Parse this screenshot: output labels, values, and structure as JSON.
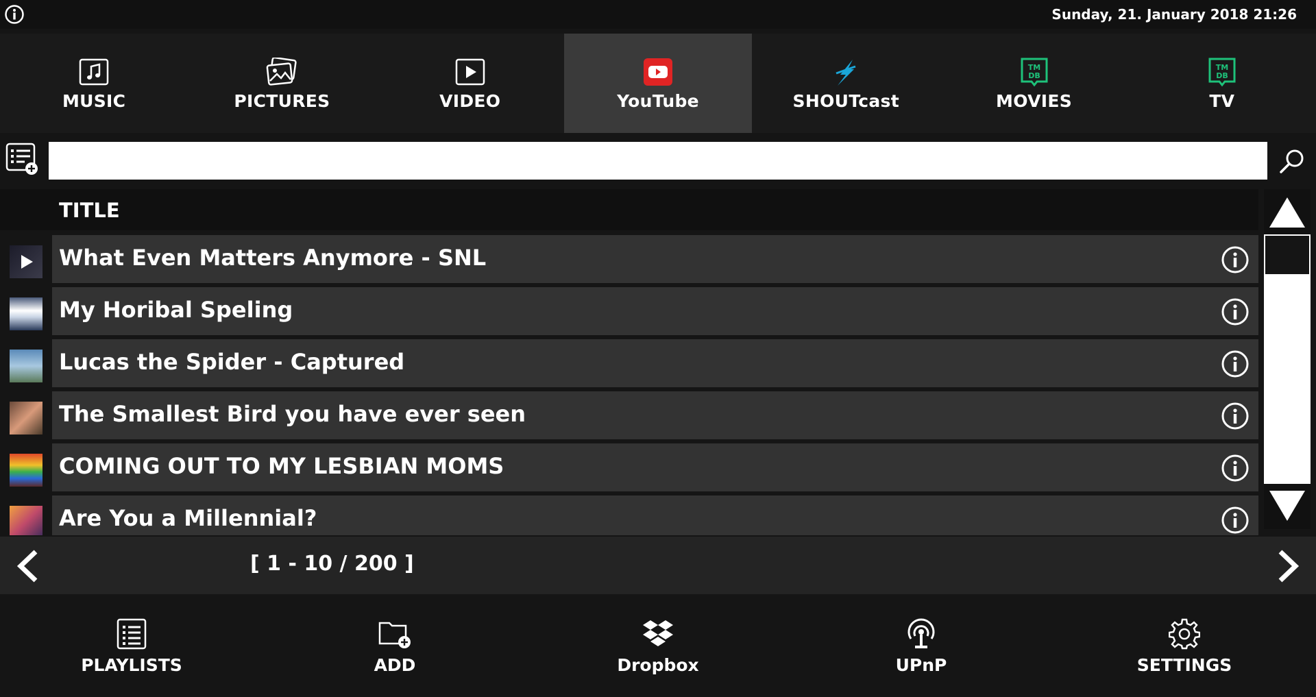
{
  "statusbar": {
    "datetime": "Sunday, 21. January 2018 21:26",
    "info_icon": "info-icon"
  },
  "tabs": [
    {
      "label": "MUSIC",
      "icon": "music-icon",
      "active": false
    },
    {
      "label": "PICTURES",
      "icon": "pictures-icon",
      "active": false
    },
    {
      "label": "VIDEO",
      "icon": "video-icon",
      "active": false
    },
    {
      "label": "YouTube",
      "icon": "youtube-icon",
      "active": true
    },
    {
      "label": "SHOUTcast",
      "icon": "shoutcast-icon",
      "active": false
    },
    {
      "label": "MOVIES",
      "icon": "tmdb-icon",
      "active": false
    },
    {
      "label": "TV",
      "icon": "tmdb-icon",
      "active": false
    }
  ],
  "tmdb_text": {
    "line1": "TM",
    "line2": "DB"
  },
  "search": {
    "value": "",
    "placeholder": ""
  },
  "list": {
    "column_title": "TITLE",
    "rows": [
      {
        "title": "What Even Matters Anymore - SNL"
      },
      {
        "title": "My Horibal Speling"
      },
      {
        "title": "Lucas the Spider - Captured"
      },
      {
        "title": "The Smallest Bird you have ever seen"
      },
      {
        "title": "COMING OUT TO MY LESBIAN MOMS"
      },
      {
        "title": "Are You a Millennial?"
      }
    ]
  },
  "pager": {
    "range": "[ 1 - 10 / 200 ]"
  },
  "bottombar": [
    {
      "label": "PLAYLISTS",
      "icon": "playlist-icon"
    },
    {
      "label": "ADD",
      "icon": "add-folder-icon"
    },
    {
      "label": "Dropbox",
      "icon": "dropbox-icon"
    },
    {
      "label": "UPnP",
      "icon": "upnp-icon"
    },
    {
      "label": "SETTINGS",
      "icon": "gear-icon"
    }
  ],
  "colors": {
    "background": "#151515",
    "active_tab": "#3a3a3a",
    "row_bg": "#333333",
    "youtube_red": "#e02424",
    "tmdb_green": "#1ec27a",
    "shoutcast_blue": "#1aa6d8"
  }
}
